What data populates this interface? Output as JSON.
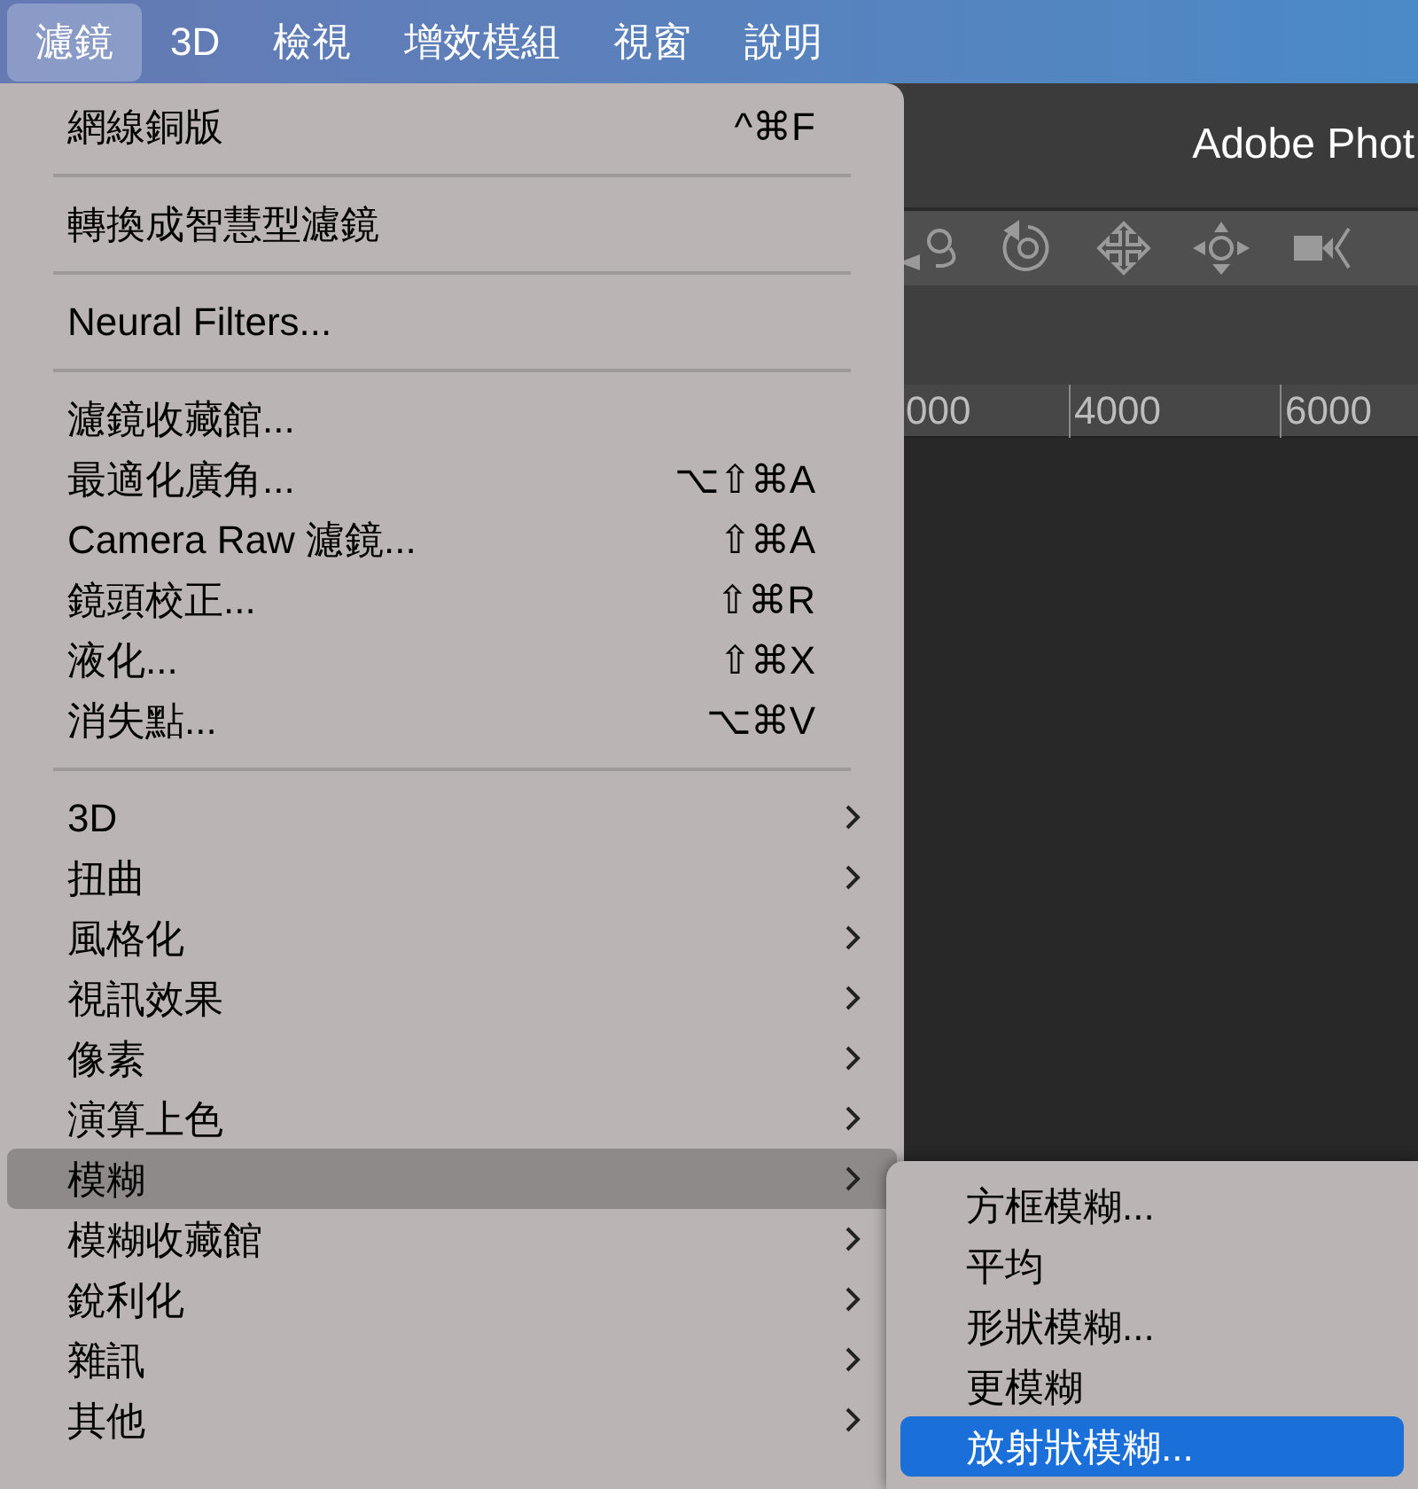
{
  "menu_bar": [
    {
      "label": "濾鏡",
      "selected": true
    },
    {
      "label": "3D",
      "selected": false
    },
    {
      "label": "檢視",
      "selected": false
    },
    {
      "label": "增效模組",
      "selected": false
    },
    {
      "label": "視窗",
      "selected": false
    },
    {
      "label": "說明",
      "selected": false
    }
  ],
  "window": {
    "title": "Adobe Phot",
    "ruler_labels": [
      "000",
      "4000",
      "6000"
    ]
  },
  "menu": [
    {
      "kind": "item",
      "label": "網線銅版",
      "shortcut": "^⌘F",
      "selected": false
    },
    {
      "kind": "separator"
    },
    {
      "kind": "item",
      "label": "轉換成智慧型濾鏡",
      "selected": false
    },
    {
      "kind": "separator"
    },
    {
      "kind": "item",
      "label": "Neural Filters...",
      "selected": false
    },
    {
      "kind": "separator"
    },
    {
      "kind": "item",
      "label": "濾鏡收藏館...",
      "selected": false
    },
    {
      "kind": "item",
      "label": "最適化廣角...",
      "shortcut": "⌥⇧⌘A",
      "selected": false
    },
    {
      "kind": "item",
      "label": "Camera Raw 濾鏡...",
      "shortcut": "⇧⌘A",
      "selected": false
    },
    {
      "kind": "item",
      "label": "鏡頭校正...",
      "shortcut": "⇧⌘R",
      "selected": false
    },
    {
      "kind": "item",
      "label": "液化...",
      "shortcut": "⇧⌘X",
      "selected": false
    },
    {
      "kind": "item",
      "label": "消失點...",
      "shortcut": "⌥⌘V",
      "selected": false
    },
    {
      "kind": "separator"
    },
    {
      "kind": "submenu",
      "label": "3D",
      "selected": false
    },
    {
      "kind": "submenu",
      "label": "扭曲",
      "selected": false
    },
    {
      "kind": "submenu",
      "label": "風格化",
      "selected": false
    },
    {
      "kind": "submenu",
      "label": "視訊效果",
      "selected": false
    },
    {
      "kind": "submenu",
      "label": "像素",
      "selected": false
    },
    {
      "kind": "submenu",
      "label": "演算上色",
      "selected": false
    },
    {
      "kind": "submenu",
      "label": "模糊",
      "selected": true
    },
    {
      "kind": "submenu",
      "label": "模糊收藏館",
      "selected": false
    },
    {
      "kind": "submenu",
      "label": "銳利化",
      "selected": false
    },
    {
      "kind": "submenu",
      "label": "雜訊",
      "selected": false
    },
    {
      "kind": "submenu",
      "label": "其他",
      "selected": false
    }
  ],
  "submenu": [
    {
      "label": "方框模糊...",
      "selected": false
    },
    {
      "label": "平均",
      "selected": false
    },
    {
      "label": "形狀模糊...",
      "selected": false
    },
    {
      "label": "更模糊",
      "selected": false
    },
    {
      "label": "放射狀模糊...",
      "selected": true
    }
  ]
}
